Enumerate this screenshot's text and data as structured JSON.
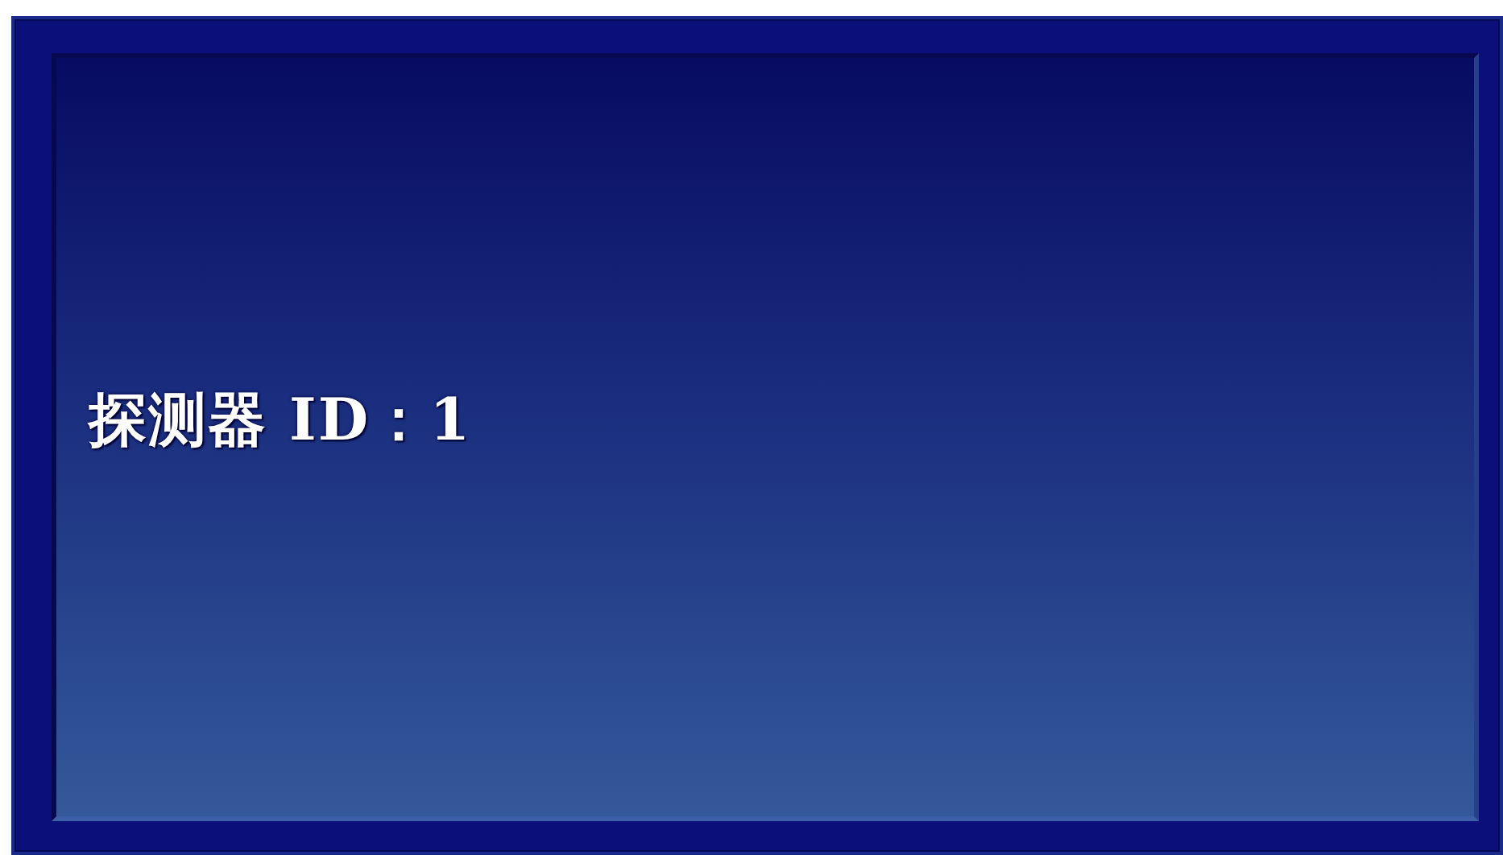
{
  "panel": {
    "label": "探测器 ID：1"
  }
}
